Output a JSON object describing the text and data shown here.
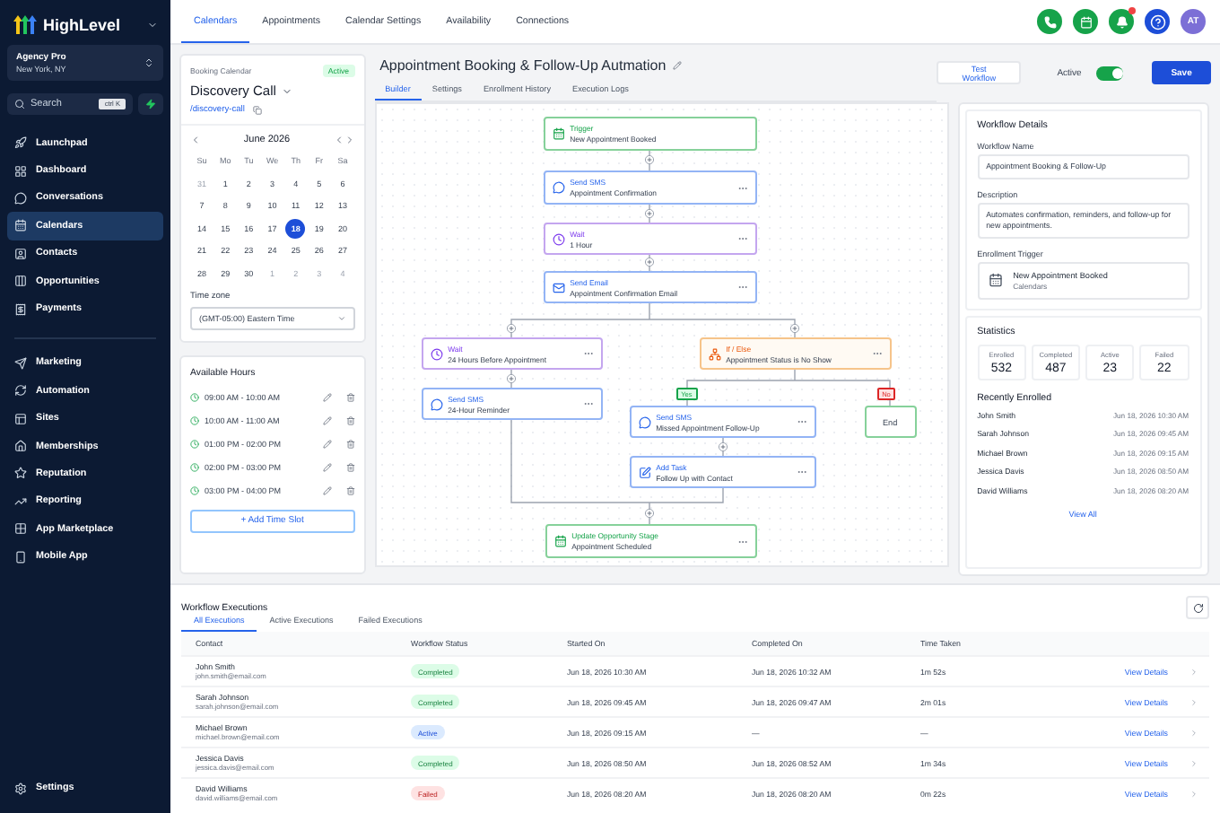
{
  "sidebar": {
    "brand": "HighLevel",
    "account": {
      "name": "Agency Pro",
      "location": "New York, NY"
    },
    "search": {
      "placeholder": "Search",
      "shortcut": "ctrl K"
    },
    "sections": [
      {
        "items": [
          {
            "label": "Launchpad",
            "selected": false
          },
          {
            "label": "Dashboard",
            "selected": false
          },
          {
            "label": "Conversations",
            "selected": false
          },
          {
            "label": "Calendars",
            "selected": true
          },
          {
            "label": "Contacts",
            "selected": false
          },
          {
            "label": "Opportunities",
            "selected": false
          },
          {
            "label": "Payments",
            "selected": false
          }
        ]
      },
      {
        "items": [
          {
            "label": "Marketing",
            "selected": false
          },
          {
            "label": "Automation",
            "selected": false
          },
          {
            "label": "Sites",
            "selected": false
          },
          {
            "label": "Memberships",
            "selected": false
          },
          {
            "label": "Reputation",
            "selected": false
          },
          {
            "label": "Reporting",
            "selected": false
          },
          {
            "label": "App Marketplace",
            "selected": false
          },
          {
            "label": "Mobile App",
            "selected": false
          }
        ]
      }
    ],
    "footer": "Settings"
  },
  "top_tabs": [
    {
      "label": "Calendars",
      "selected": true
    },
    {
      "label": "Appointments",
      "selected": false
    },
    {
      "label": "Calendar Settings",
      "selected": false
    },
    {
      "label": "Availability",
      "selected": false
    },
    {
      "label": "Connections",
      "selected": false
    }
  ],
  "header": {
    "notifications_unread": true,
    "avatar": "AT"
  },
  "calendar_panel": {
    "caption": "Booking Calendar",
    "status": "Active",
    "name": "Discovery Call",
    "link": "/discovery-call",
    "month": "June 2026",
    "weekdays": [
      "Su",
      "Mo",
      "Tu",
      "We",
      "Th",
      "Fr",
      "Sa"
    ],
    "days": [
      {
        "label": "31",
        "muted": true,
        "selected": false
      },
      {
        "label": "1",
        "muted": false,
        "selected": false
      },
      {
        "label": "2",
        "muted": false,
        "selected": false
      },
      {
        "label": "3",
        "muted": false,
        "selected": false
      },
      {
        "label": "4",
        "muted": false,
        "selected": false
      },
      {
        "label": "5",
        "muted": false,
        "selected": false
      },
      {
        "label": "6",
        "muted": false,
        "selected": false
      },
      {
        "label": "7",
        "muted": false,
        "selected": false
      },
      {
        "label": "8",
        "muted": false,
        "selected": false
      },
      {
        "label": "9",
        "muted": false,
        "selected": false
      },
      {
        "label": "10",
        "muted": false,
        "selected": false
      },
      {
        "label": "11",
        "muted": false,
        "selected": false
      },
      {
        "label": "12",
        "muted": false,
        "selected": false
      },
      {
        "label": "13",
        "muted": false,
        "selected": false
      },
      {
        "label": "14",
        "muted": false,
        "selected": false
      },
      {
        "label": "15",
        "muted": false,
        "selected": false
      },
      {
        "label": "16",
        "muted": false,
        "selected": false
      },
      {
        "label": "17",
        "muted": false,
        "selected": false
      },
      {
        "label": "18",
        "muted": false,
        "selected": true
      },
      {
        "label": "19",
        "muted": false,
        "selected": false
      },
      {
        "label": "20",
        "muted": false,
        "selected": false
      },
      {
        "label": "21",
        "muted": false,
        "selected": false
      },
      {
        "label": "22",
        "muted": false,
        "selected": false
      },
      {
        "label": "23",
        "muted": false,
        "selected": false
      },
      {
        "label": "24",
        "muted": false,
        "selected": false
      },
      {
        "label": "25",
        "muted": false,
        "selected": false
      },
      {
        "label": "26",
        "muted": false,
        "selected": false
      },
      {
        "label": "27",
        "muted": false,
        "selected": false
      },
      {
        "label": "28",
        "muted": false,
        "selected": false
      },
      {
        "label": "29",
        "muted": false,
        "selected": false
      },
      {
        "label": "30",
        "muted": false,
        "selected": false
      },
      {
        "label": "1",
        "muted": true,
        "selected": false
      },
      {
        "label": "2",
        "muted": true,
        "selected": false
      },
      {
        "label": "3",
        "muted": true,
        "selected": false
      },
      {
        "label": "4",
        "muted": true,
        "selected": false
      }
    ],
    "timezone_label": "Time zone",
    "timezone": "(GMT-05:00) Eastern Time",
    "hours_title": "Available Hours",
    "slots": [
      "09:00 AM - 10:00 AM",
      "10:00 AM - 11:00 AM",
      "01:00 PM - 02:00 PM",
      "02:00 PM - 03:00 PM",
      "03:00 PM - 04:00 PM"
    ],
    "add_button": "+ Add Time Slot"
  },
  "workflow": {
    "title": "Appointment Booking & Follow-Up Autmation",
    "tabs": [
      {
        "label": "Builder",
        "selected": true
      },
      {
        "label": "Settings",
        "selected": false
      },
      {
        "label": "Enrollment History",
        "selected": false
      },
      {
        "label": "Execution Logs",
        "selected": false
      }
    ],
    "test_button": "Test Workflow",
    "active_label": "Active",
    "active": true,
    "save_button": "Save",
    "nodes": [
      {
        "kind": "trigger",
        "title": "Trigger",
        "subtitle": "New Appointment Booked"
      },
      {
        "kind": "sms",
        "title": "Send SMS",
        "subtitle": "Appointment Confirmation"
      },
      {
        "kind": "wait",
        "title": "Wait",
        "subtitle": "1 Hour"
      },
      {
        "kind": "email",
        "title": "Send Email",
        "subtitle": "Appointment Confirmation Email"
      },
      {
        "kind": "wait",
        "title": "Wait",
        "subtitle": "24 Hours Before Appointment"
      },
      {
        "kind": "ifelse",
        "title": "If / Else",
        "subtitle": "Appointment Status is No Show"
      },
      {
        "kind": "sms",
        "title": "Send SMS",
        "subtitle": "24-Hour Reminder"
      },
      {
        "kind": "sms",
        "title": "Send SMS",
        "subtitle": "Missed Appointment Follow-Up"
      },
      {
        "kind": "end",
        "title": "End"
      },
      {
        "kind": "task",
        "title": "Add Task",
        "subtitle": "Follow Up with Contact"
      },
      {
        "kind": "update",
        "title": "Update Opportunity Stage",
        "subtitle": "Appointment Scheduled"
      }
    ],
    "branch_labels": [
      {
        "kind": "yes",
        "label": "Yes"
      },
      {
        "kind": "no",
        "label": "No"
      }
    ]
  },
  "details": {
    "title": "Workflow Details",
    "name_label": "Workflow Name",
    "name": "Appointment Booking & Follow-Up",
    "description_label": "Description",
    "description": "Automates confirmation, reminders, and follow-up for new appointments.",
    "trigger_label": "Enrollment Trigger",
    "trigger": {
      "title": "New Appointment Booked",
      "subtitle": "Calendars"
    },
    "stats_title": "Statistics",
    "stats": [
      {
        "label": "Enrolled",
        "value": "532"
      },
      {
        "label": "Completed",
        "value": "487"
      },
      {
        "label": "Active",
        "value": "23"
      },
      {
        "label": "Failed",
        "value": "22"
      }
    ],
    "recent_title": "Recently Enrolled",
    "recent": [
      {
        "name": "John Smith",
        "date": "Jun 18, 2026 10:30 AM"
      },
      {
        "name": "Sarah Johnson",
        "date": "Jun 18, 2026 09:45 AM"
      },
      {
        "name": "Michael Brown",
        "date": "Jun 18, 2026 09:15 AM"
      },
      {
        "name": "Jessica Davis",
        "date": "Jun 18, 2026 08:50 AM"
      },
      {
        "name": "David Williams",
        "date": "Jun 18, 2026 08:20 AM"
      }
    ],
    "view_all": "View All"
  },
  "executions": {
    "title": "Workflow Executions",
    "tabs": [
      {
        "label": "All Executions",
        "selected": true
      },
      {
        "label": "Active Executions",
        "selected": false
      },
      {
        "label": "Failed Executions",
        "selected": false
      }
    ],
    "columns": [
      "Contact",
      "Workflow Status",
      "Started On",
      "Completed On",
      "Time Taken"
    ],
    "rows": [
      {
        "name": "John Smith",
        "email": "john.smith@email.com",
        "status": "Completed",
        "color": "#dcfce7",
        "started": "Jun 18, 2026 10:30 AM",
        "completed": "Jun 18, 2026 10:32 AM",
        "time": "1m 52s",
        "action": "View Details"
      },
      {
        "name": "Sarah Johnson",
        "email": "sarah.johnson@email.com",
        "status": "Completed",
        "color": "#dcfce7",
        "started": "Jun 18, 2026 09:45 AM",
        "completed": "Jun 18, 2026 09:47 AM",
        "time": "2m 01s",
        "action": "View Details"
      },
      {
        "name": "Michael Brown",
        "email": "michael.brown@email.com",
        "status": "Active",
        "color": "#dbeafe",
        "started": "Jun 18, 2026 09:15 AM",
        "completed": "—",
        "time": "—",
        "action": "View Details"
      },
      {
        "name": "Jessica Davis",
        "email": "jessica.davis@email.com",
        "status": "Completed",
        "color": "#dcfce7",
        "started": "Jun 18, 2026 08:50 AM",
        "completed": "Jun 18, 2026 08:52 AM",
        "time": "1m 34s",
        "action": "View Details"
      },
      {
        "name": "David Williams",
        "email": "david.williams@email.com",
        "status": "Failed",
        "color": "#fee2e2",
        "started": "Jun 18, 2026 08:20 AM",
        "completed": "Jun 18, 2026 08:20 AM",
        "time": "0m 22s",
        "action": "View Details"
      }
    ]
  }
}
